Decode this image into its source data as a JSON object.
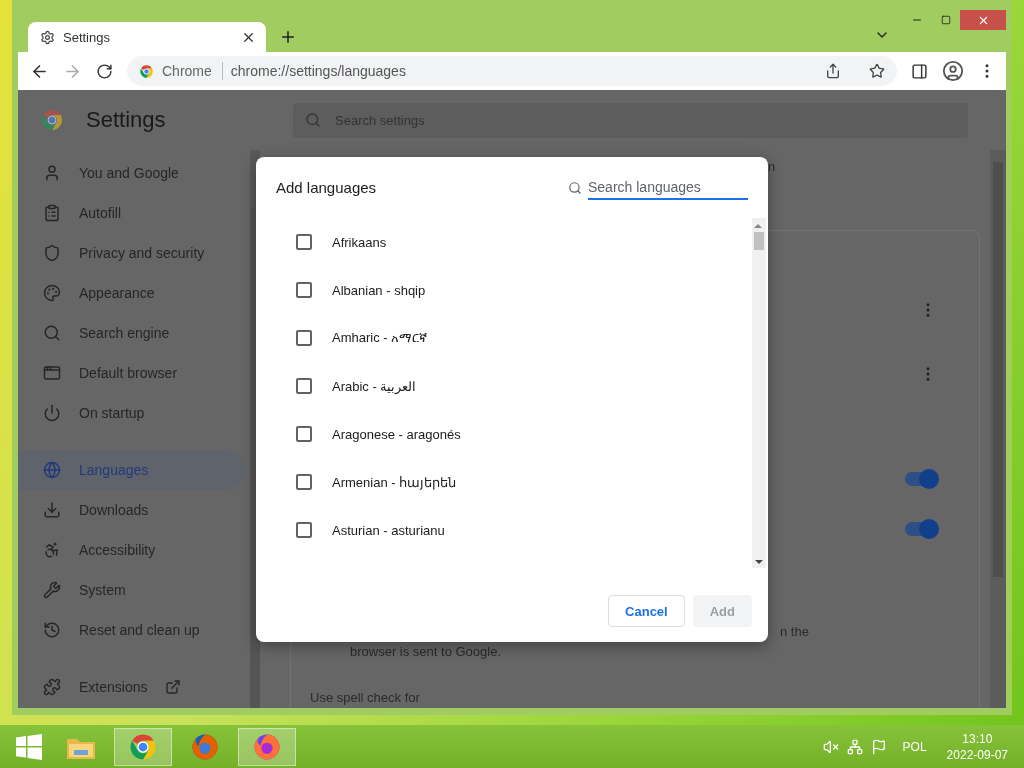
{
  "browser": {
    "tab": {
      "title": "Settings"
    },
    "omnibox": {
      "chip": "Chrome",
      "url": "chrome://settings/languages"
    }
  },
  "settings": {
    "title": "Settings",
    "search": {
      "placeholder": "Search settings"
    },
    "nav": [
      {
        "label": "You and Google",
        "selected": false
      },
      {
        "label": "Autofill",
        "selected": false
      },
      {
        "label": "Privacy and security",
        "selected": false
      },
      {
        "label": "Appearance",
        "selected": false
      },
      {
        "label": "Search engine",
        "selected": false
      },
      {
        "label": "Default browser",
        "selected": false
      },
      {
        "label": "On startup",
        "selected": false
      },
      {
        "label": "Languages",
        "selected": true
      },
      {
        "label": "Downloads",
        "selected": false
      },
      {
        "label": "Accessibility",
        "selected": false
      },
      {
        "label": "System",
        "selected": false
      },
      {
        "label": "Reset and clean up",
        "selected": false
      },
      {
        "label": "Extensions",
        "selected": false
      }
    ],
    "page_text": {
      "line_1": "n",
      "line_2": "n the",
      "line_3": "browser is sent to Google.",
      "line_4": "Use spell check for"
    },
    "toggles": [
      {
        "on": true
      },
      {
        "on": true
      }
    ]
  },
  "dialog": {
    "title": "Add languages",
    "search": {
      "placeholder": "Search languages"
    },
    "languages": [
      {
        "label": "Afrikaans",
        "checked": false
      },
      {
        "label": "Albanian - shqip",
        "checked": false
      },
      {
        "label": "Amharic - አማርኛ",
        "checked": false
      },
      {
        "label": "Arabic - العربية",
        "checked": false
      },
      {
        "label": "Aragonese - aragonés",
        "checked": false
      },
      {
        "label": "Armenian - հայերեն",
        "checked": false
      },
      {
        "label": "Asturian - asturianu",
        "checked": false
      }
    ],
    "buttons": [
      {
        "label": "Cancel",
        "disabled": false
      },
      {
        "label": "Add",
        "disabled": true
      }
    ]
  },
  "taskbar": {
    "apps": [
      {
        "active": false
      },
      {
        "active": true
      },
      {
        "active": false
      },
      {
        "active": true
      }
    ],
    "language": "POL",
    "time": "13:10",
    "date": "2022-09-07"
  }
}
